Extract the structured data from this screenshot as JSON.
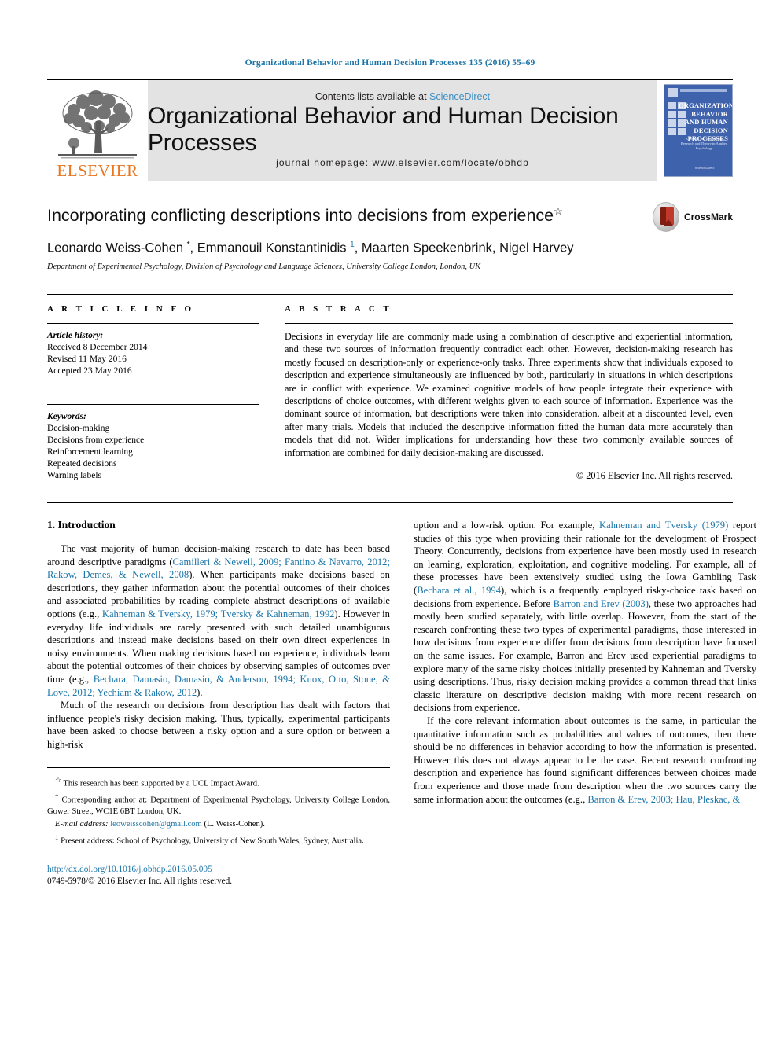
{
  "running_head": "Organizational Behavior and Human Decision Processes 135 (2016) 55–69",
  "masthead": {
    "publisher_name": "ELSEVIER",
    "contents_prefix": "Contents lists available at ",
    "sciencedirect": "ScienceDirect",
    "journal_name": "Organizational Behavior and Human Decision Processes",
    "homepage": "journal homepage: www.elsevier.com/locate/obhdp",
    "cover": {
      "title_line1": "ORGANIZATIONAL",
      "title_line2": "BEHAVIOR",
      "title_line3": "AND HUMAN",
      "title_line4": "DECISION PROCESSES",
      "subtitle": "A Journal of Fundamental Research and Theory in Applied Psychology",
      "footer": "ScienceDirect"
    },
    "accent_blue": "#3a8fc4",
    "elsevier_orange": "#e87722",
    "cover_blue": "#3f62ad"
  },
  "article": {
    "title": "Incorporating conflicting descriptions into decisions from experience",
    "title_marker": "☆",
    "authors_html": "Leonardo Weiss-Cohen <sup class=\"ast\">*</sup>, Emmanouil Konstantinidis <sup>1</sup>, Maarten Speekenbrink, Nigel Harvey",
    "affiliation": "Department of Experimental Psychology, Division of Psychology and Language Sciences, University College London, London, UK",
    "crossmark_label": "CrossMark"
  },
  "article_info": {
    "heading": "A R T I C L E   I N F O",
    "history_label": "Article history:",
    "history": [
      "Received 8 December 2014",
      "Revised 11 May 2016",
      "Accepted 23 May 2016"
    ],
    "keywords_label": "Keywords:",
    "keywords": [
      "Decision-making",
      "Decisions from experience",
      "Reinforcement learning",
      "Repeated decisions",
      "Warning labels"
    ]
  },
  "abstract": {
    "heading": "A B S T R A C T",
    "text": "Decisions in everyday life are commonly made using a combination of descriptive and experiential information, and these two sources of information frequently contradict each other. However, decision-making research has mostly focused on description-only or experience-only tasks. Three experiments show that individuals exposed to description and experience simultaneously are influenced by both, particularly in situations in which descriptions are in conflict with experience. We examined cognitive models of how people integrate their experience with descriptions of choice outcomes, with different weights given to each source of information. Experience was the dominant source of information, but descriptions were taken into consideration, albeit at a discounted level, even after many trials. Models that included the descriptive information fitted the human data more accurately than models that did not. Wider implications for understanding how these two commonly available sources of information are combined for daily decision-making are discussed.",
    "copyright": "© 2016 Elsevier Inc. All rights reserved."
  },
  "body": {
    "section_number_title": "1. Introduction",
    "left": {
      "p1_a": "The vast majority of human decision-making research to date has been based around descriptive paradigms (",
      "p1_ref1": "Camilleri & Newell, 2009; Fantino & Navarro, 2012; Rakow, Demes, & Newell, 2008",
      "p1_b": "). When participants make decisions based on descriptions, they gather information about the potential outcomes of their choices and associated probabilities by reading complete abstract descriptions of available options (e.g., ",
      "p1_ref2": "Kahneman & Tversky, 1979; Tversky & Kahneman, 1992",
      "p1_c": "). However in everyday life individuals are rarely presented with such detailed unambiguous descriptions and instead make decisions based on their own direct experiences in noisy environments. When making decisions based on experience, individuals learn about the potential outcomes of their choices by observing samples of outcomes over time (e.g., ",
      "p1_ref3": "Bechara, Damasio, Damasio, & Anderson, 1994; Knox, Otto, Stone, & Love, 2012; Yechiam & Rakow, 2012",
      "p1_d": ").",
      "p2": "Much of the research on decisions from description has dealt with factors that influence people's risky decision making. Thus, typically, experimental participants have been asked to choose between a risky option and a sure option or between a high-risk"
    },
    "right": {
      "p1_a": "option and a low-risk option. For example, ",
      "p1_ref1": "Kahneman and Tversky (1979)",
      "p1_b": " report studies of this type when providing their rationale for the development of Prospect Theory. Concurrently, decisions from experience have been mostly used in research on learning, exploration, exploitation, and cognitive modeling. For example, all of these processes have been extensively studied using the Iowa Gambling Task (",
      "p1_ref2": "Bechara et al., 1994",
      "p1_c": "), which is a frequently employed risky-choice task based on decisions from experience. Before ",
      "p1_ref3": "Barron and Erev (2003)",
      "p1_d": ", these two approaches had mostly been studied separately, with little overlap. However, from the start of the research confronting these two types of experimental paradigms, those interested in how decisions from experience differ from decisions from description have focused on the same issues. For example, Barron and Erev used experiential paradigms to explore many of the same risky choices initially presented by Kahneman and Tversky using descriptions. Thus, risky decision making provides a common thread that links classic literature on descriptive decision making with more recent research on decisions from experience.",
      "p2_a": "If the core relevant information about outcomes is the same, in particular the quantitative information such as probabilities and values of outcomes, then there should be no differences in behavior according to how the information is presented. However this does not always appear to be the case. Recent research confronting description and experience has found significant differences between choices made from experience and those made from description when the two sources carry the same information about the outcomes (e.g., ",
      "p2_ref1": "Barron & Erev, 2003; Hau, Pleskac, &"
    }
  },
  "footnotes": {
    "star_marker": "☆",
    "star_text": "This research has been supported by a UCL Impact Award.",
    "corr_marker": "*",
    "corr_text": "Corresponding author at: Department of Experimental Psychology, University College London, Gower Street, WC1E 6BT London, UK.",
    "email_label": "E-mail address:",
    "email": "leoweisscohen@gmail.com",
    "email_suffix": "(L. Weiss-Cohen).",
    "present_marker": "1",
    "present_text": "Present address: School of Psychology, University of New South Wales, Sydney, Australia."
  },
  "doi_block": {
    "doi_url": "http://dx.doi.org/10.1016/j.obhdp.2016.05.005",
    "issn_line": "0749-5978/© 2016 Elsevier Inc. All rights reserved."
  }
}
